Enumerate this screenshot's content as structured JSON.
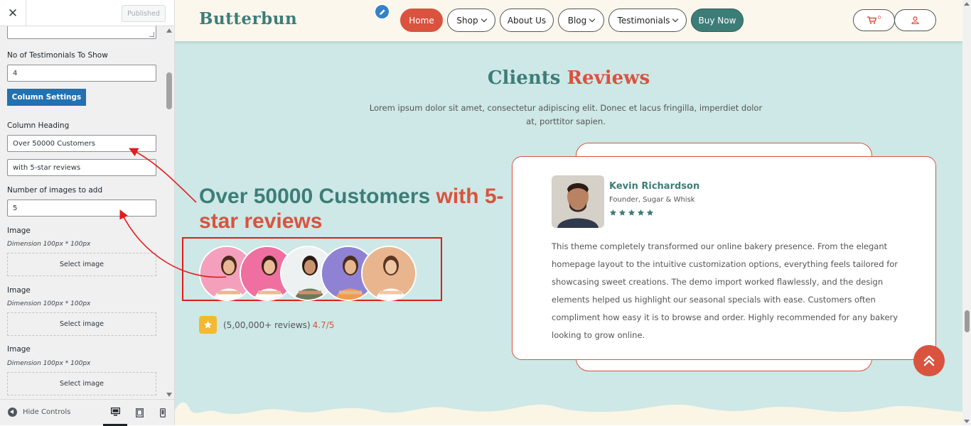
{
  "sidebar": {
    "publish_label": "Published",
    "testimonials_count_label": "No of Testimonials To Show",
    "testimonials_count_value": "4",
    "column_settings_label": "Column Settings",
    "column_heading_label": "Column Heading",
    "column_heading_value": "Over 50000 Customers",
    "column_subheading_value": "with 5-star reviews",
    "images_count_label": "Number of images to add",
    "images_count_value": "5",
    "image_fields": [
      {
        "label": "Image",
        "dimension": "Dimension 100px * 100px",
        "button": "Select image"
      },
      {
        "label": "Image",
        "dimension": "Dimension 100px * 100px",
        "button": "Select image"
      },
      {
        "label": "Image",
        "dimension": "Dimension 100px * 100px",
        "button": "Select image"
      }
    ],
    "hide_controls_label": "Hide Controls"
  },
  "site": {
    "logo": "Butterbun",
    "nav": [
      {
        "label": "Home",
        "dropdown": false
      },
      {
        "label": "Shop",
        "dropdown": true
      },
      {
        "label": "About Us",
        "dropdown": false
      },
      {
        "label": "Blog",
        "dropdown": true
      },
      {
        "label": "Testimonials",
        "dropdown": true
      },
      {
        "label": "Buy Now",
        "dropdown": false
      }
    ],
    "cart_count": "0"
  },
  "section": {
    "title_part1": "Clients",
    "title_part2": "Reviews",
    "description": "Lorem ipsum dolor sit amet, consectetur adipiscing elit. Donec et lacus fringilla, imperdiet dolor at, porttitor sapien.",
    "heading_part1": "Over 50000 Customers",
    "heading_part2": "with 5-star reviews",
    "reviews_count": "(5,00,000+ reviews)",
    "rating_score": "4.7/5"
  },
  "testimonial": {
    "name": "Kevin Richardson",
    "role": "Founder, Sugar & Whisk",
    "stars": 5,
    "text": "This theme completely transformed our online bakery presence. From the elegant homepage layout to the intuitive customization options, everything feels tailored for showcasing sweet creations. The demo import worked flawlessly, and the design elements helped us highlight our seasonal specials with ease. Customers often compliment how easy it is to browse and order. Highly recommended for any bakery looking to grow online."
  },
  "colors": {
    "teal": "#3d7d78",
    "coral": "#d9533e",
    "section_bg": "#cde8e6",
    "header_bg": "#fcf7ec",
    "wp_blue": "#2271b1",
    "annotation_red": "#e11d1d"
  },
  "icons": [
    "close-icon",
    "pencil-icon",
    "cart-icon",
    "user-icon",
    "star-icon",
    "chevron-up-icon",
    "desktop-icon",
    "tablet-icon",
    "mobile-icon"
  ]
}
